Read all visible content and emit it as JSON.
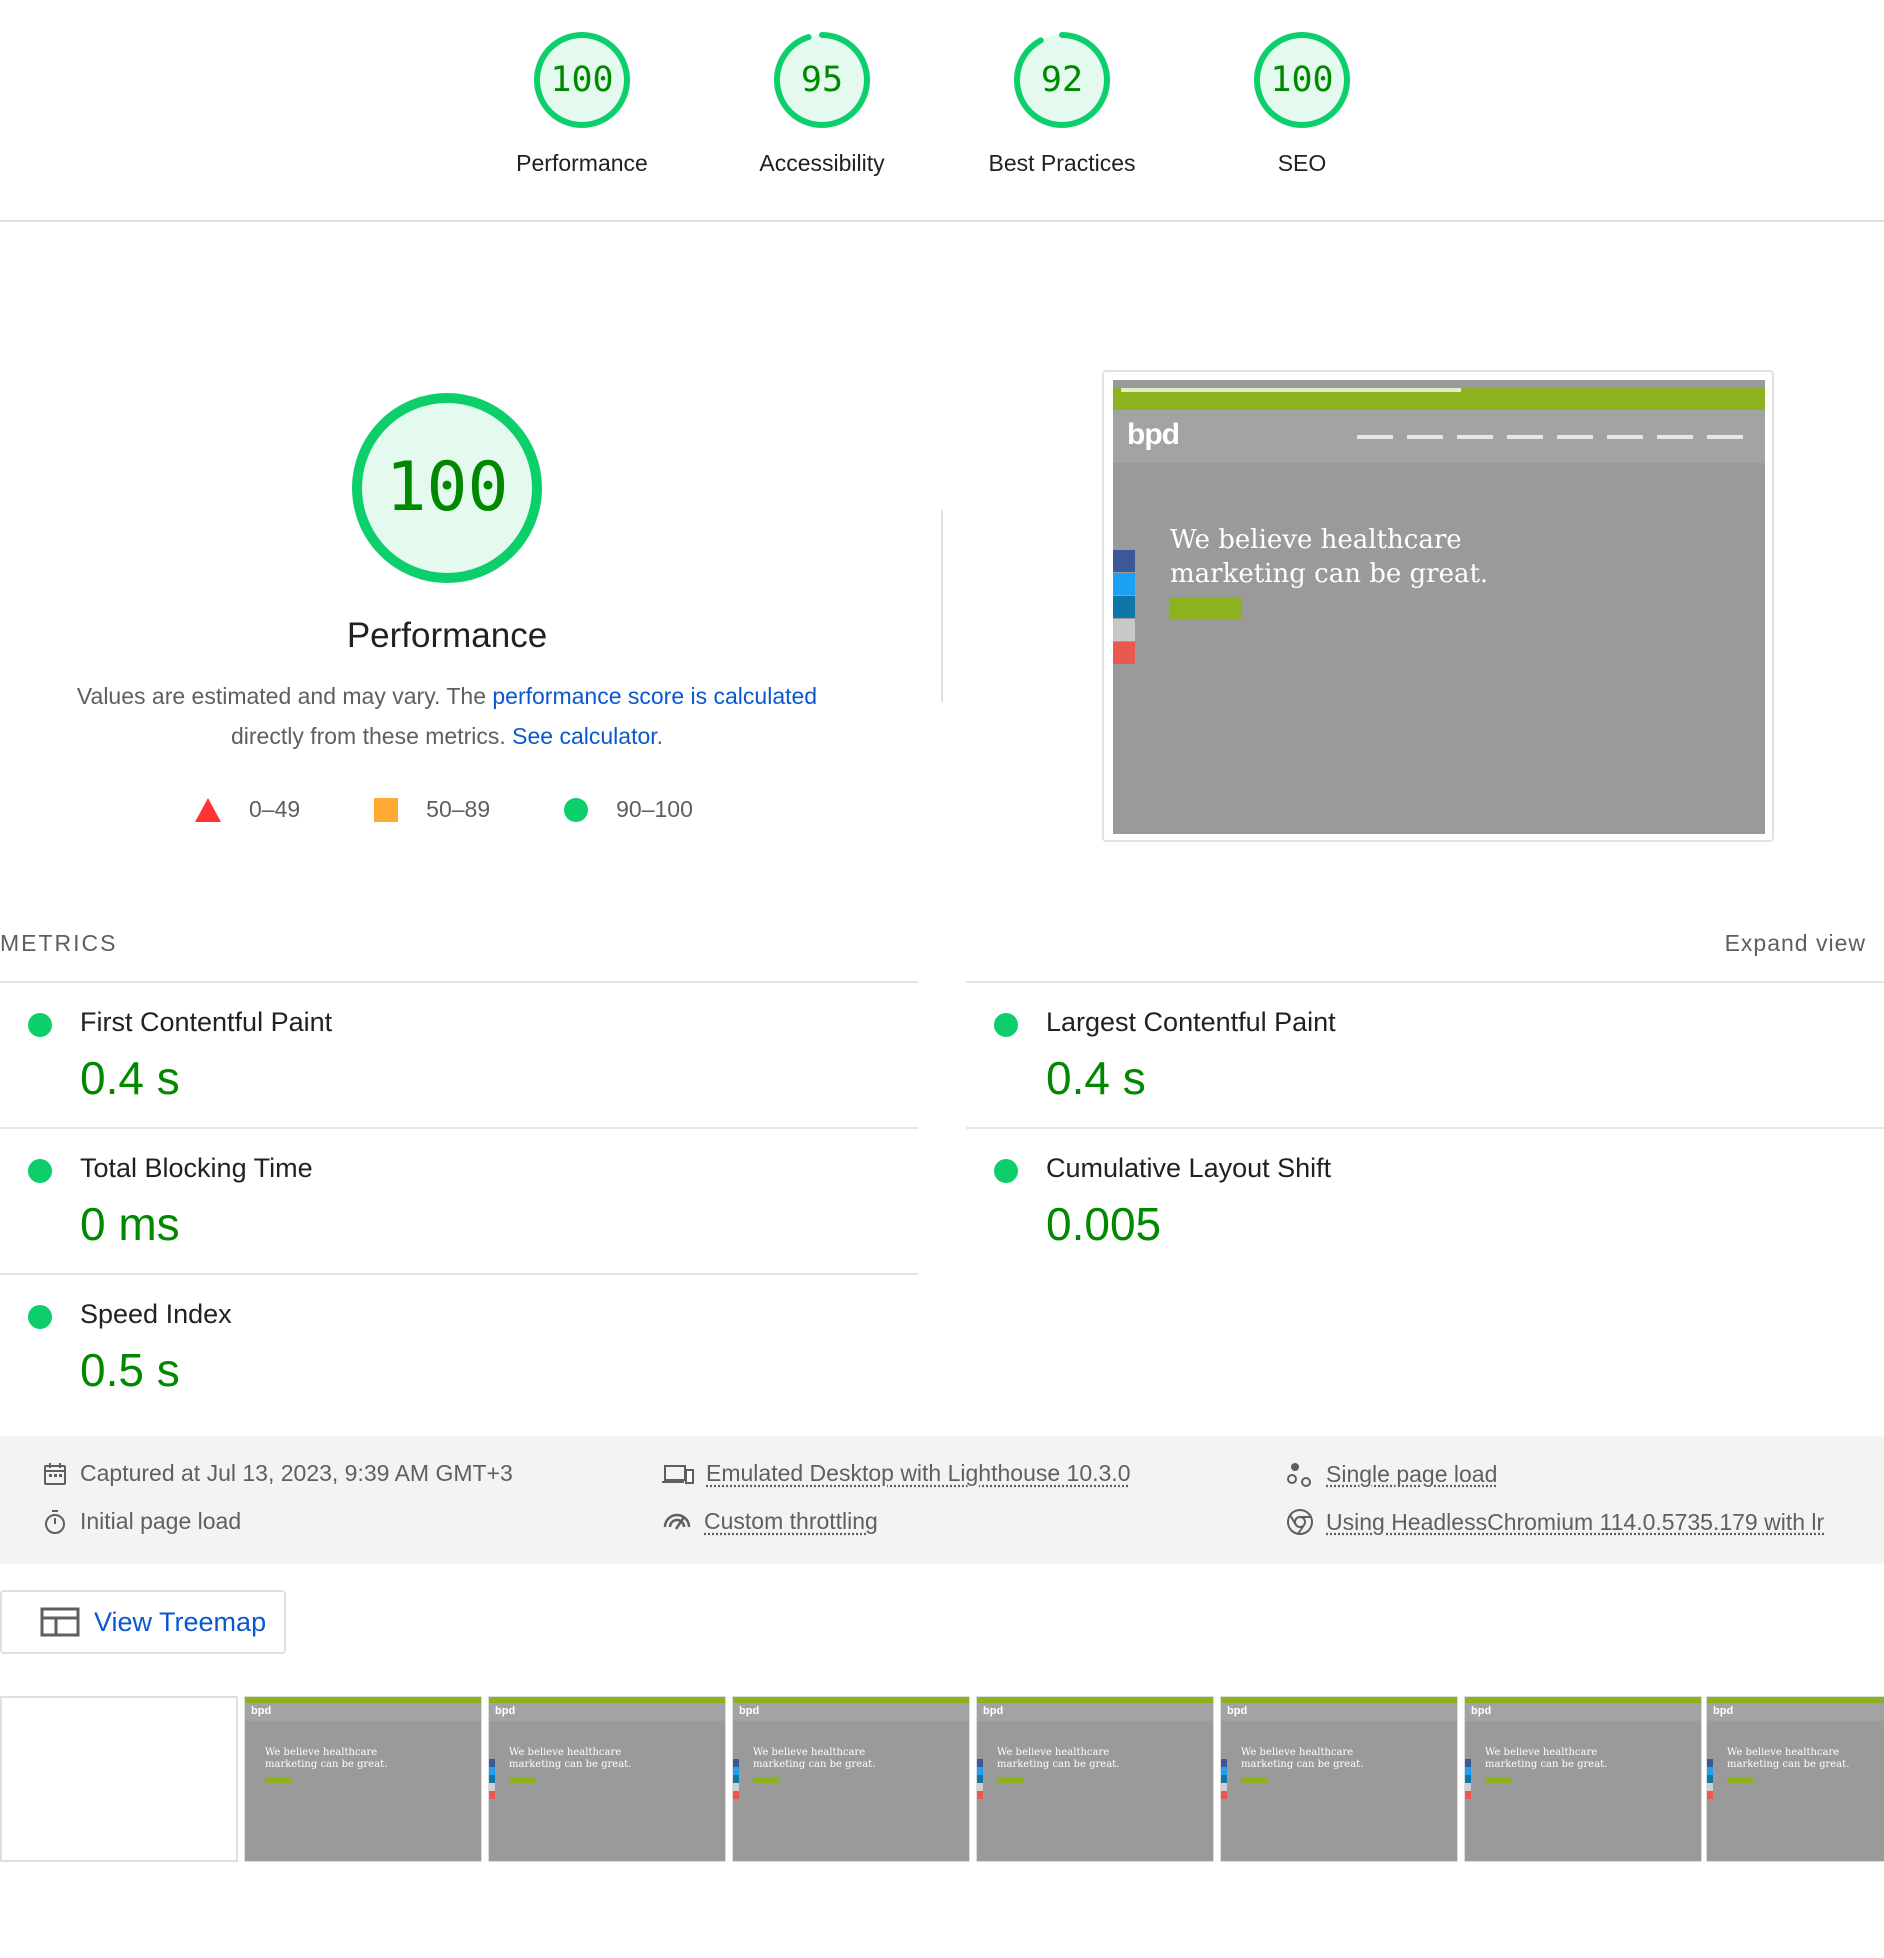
{
  "scores": [
    {
      "value": "100",
      "label": "Performance",
      "fraction": 1.0
    },
    {
      "value": "95",
      "label": "Accessibility",
      "fraction": 0.95
    },
    {
      "value": "92",
      "label": "Best Practices",
      "fraction": 0.92
    },
    {
      "value": "100",
      "label": "SEO",
      "fraction": 1.0
    }
  ],
  "performance": {
    "score": "100",
    "score_fraction": 1.0,
    "title": "Performance",
    "desc_part1": "Values are estimated and may vary. The ",
    "desc_link1": "performance score is calculated",
    "desc_part2": " directly from these metrics. ",
    "desc_link2": "See calculator",
    "desc_part3": "."
  },
  "legend": [
    {
      "shape": "triangle",
      "label": "0–49",
      "color": "#ff3333"
    },
    {
      "shape": "square",
      "label": "50–89",
      "color": "#ffaa33"
    },
    {
      "shape": "circle",
      "label": "90–100",
      "color": "#0cce6b"
    }
  ],
  "preview": {
    "logo": "bpd",
    "hero_line1": "We believe healthcare",
    "hero_line2": "marketing can be great."
  },
  "metrics": {
    "heading": "METRICS",
    "expand": "Expand view",
    "items": [
      {
        "name": "First Contentful Paint",
        "value": "0.4 s"
      },
      {
        "name": "Largest Contentful Paint",
        "value": "0.4 s"
      },
      {
        "name": "Total Blocking Time",
        "value": "0 ms"
      },
      {
        "name": "Cumulative Layout Shift",
        "value": "0.005"
      },
      {
        "name": "Speed Index",
        "value": "0.5 s"
      }
    ]
  },
  "environment": {
    "captured": "Captured at Jul 13, 2023, 9:39 AM GMT+3",
    "initial_load": "Initial page load",
    "emulated": "Emulated Desktop with Lighthouse 10.3.0",
    "throttling": "Custom throttling",
    "single_load": "Single page load",
    "browser": "Using HeadlessChromium 114.0.5735.179 with lr"
  },
  "treemap": {
    "label": "View Treemap"
  },
  "filmstrip": {
    "hero_line1": "We believe healthcare",
    "hero_line2": "marketing can be great."
  },
  "colors": {
    "pass": "#0cce6b",
    "pass_text": "#008800",
    "pass_bg": "#e5faef",
    "link": "#0b57d0"
  }
}
